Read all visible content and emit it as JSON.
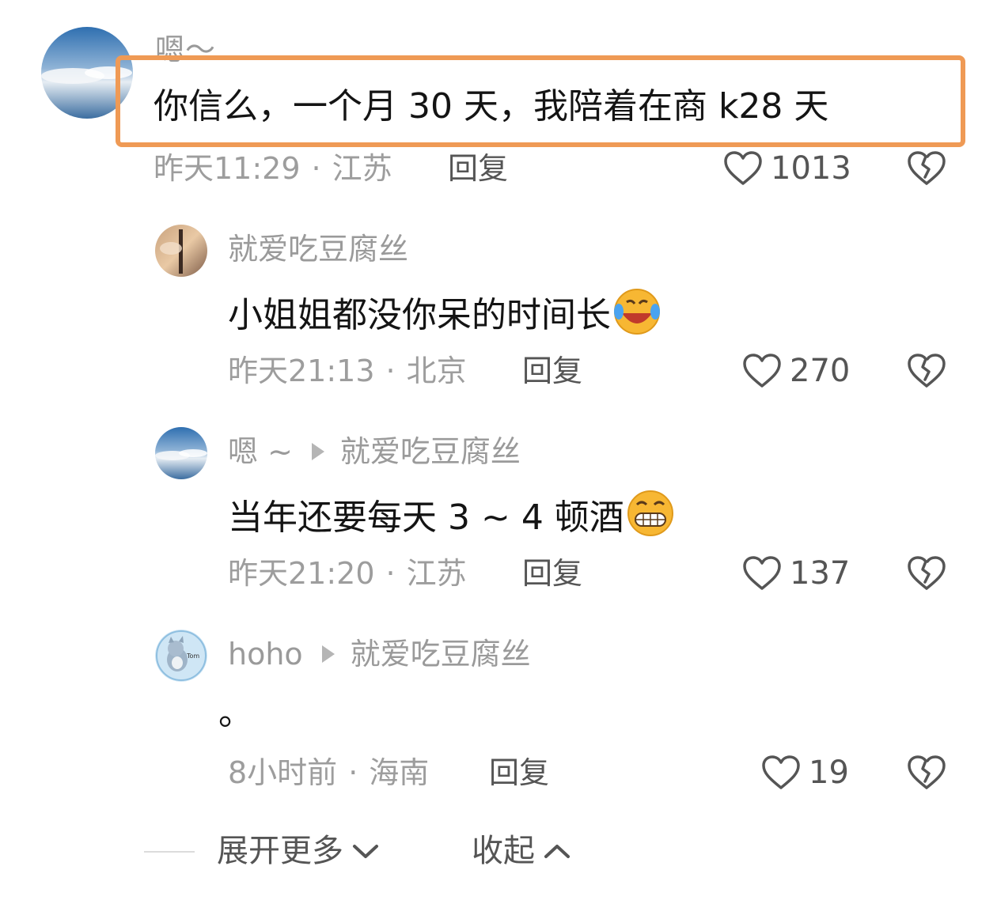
{
  "comments": [
    {
      "username": "嗯～",
      "text": "你信么，一个月 30 天，我陪着在商 k28 天",
      "time": "昨天11:29",
      "location": "江苏",
      "reply_label": "回复",
      "likes": "1013"
    },
    {
      "username": "就爱吃豆腐丝",
      "text": "小姐姐都没你呆的时间长",
      "time": "昨天21:13",
      "location": "北京",
      "reply_label": "回复",
      "likes": "270"
    },
    {
      "username": "嗯 ~",
      "reply_to": "就爱吃豆腐丝",
      "text": "当年还要每天 3 ~ 4 顿酒",
      "time": "昨天21:20",
      "location": "江苏",
      "reply_label": "回复",
      "likes": "137"
    },
    {
      "username": "hoho",
      "reply_to": "就爱吃豆腐丝",
      "text": "。",
      "time": "8小时前",
      "location": "海南",
      "reply_label": "回复",
      "likes": "19"
    }
  ],
  "footer": {
    "expand_more": "展开更多",
    "collapse": "收起"
  },
  "colors": {
    "highlight_border": "#ef9a55",
    "meta_text": "#9d9d9d"
  },
  "icons": {
    "like": "heart-outline-icon",
    "dislike": "broken-heart-icon",
    "expand": "chevron-down-icon",
    "collapse": "chevron-up-icon"
  }
}
